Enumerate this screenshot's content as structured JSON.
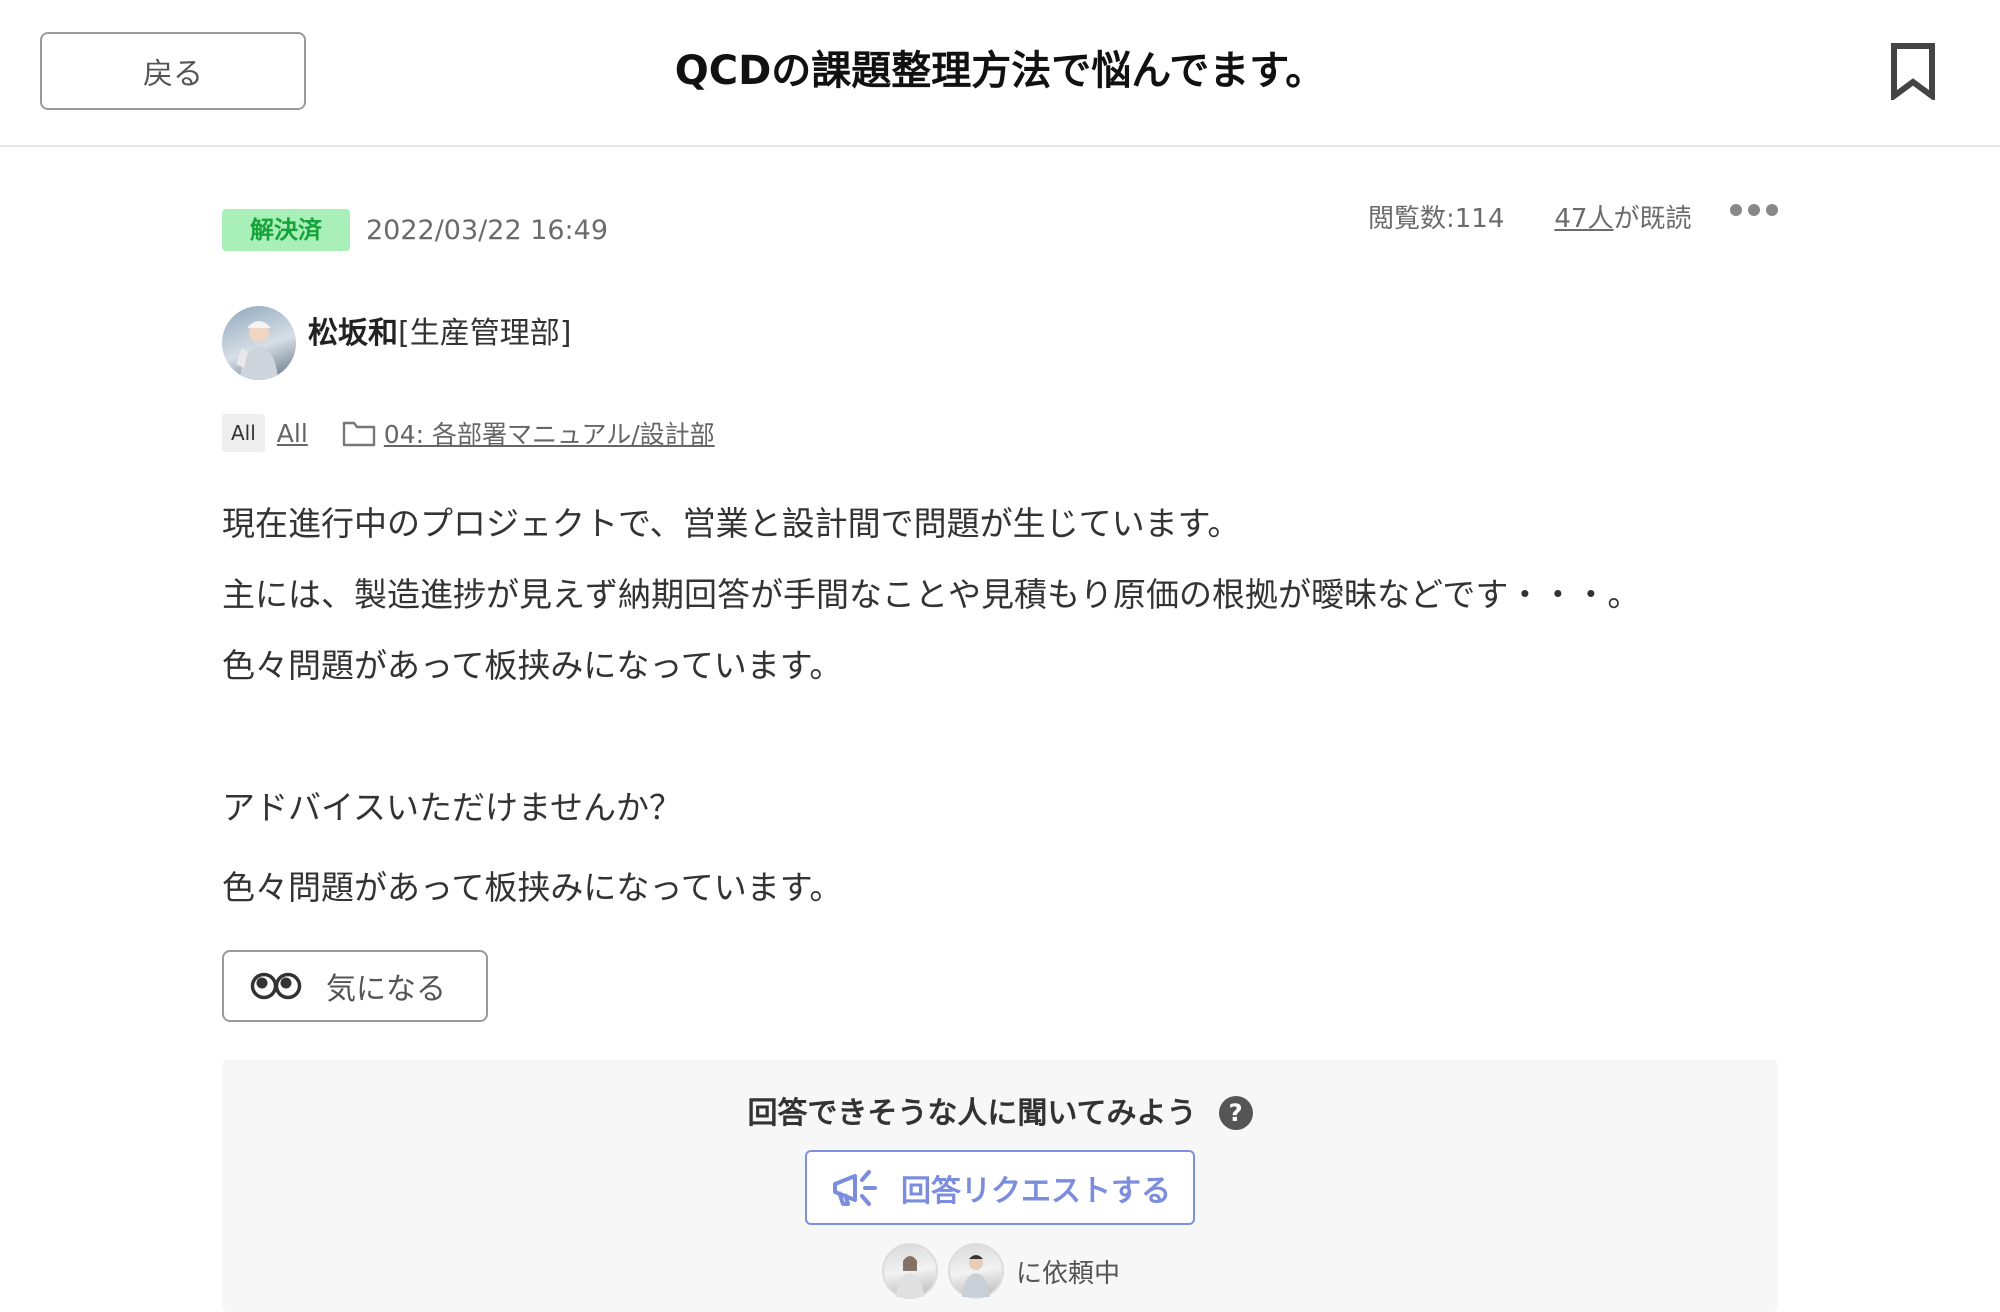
{
  "header": {
    "back_label": "戻る",
    "title": "QCDの課題整理方法で悩んでます。"
  },
  "post": {
    "status": "解決済",
    "date": "2022/03/22 16:49",
    "views": "閲覧数:114",
    "readers_count": "47人",
    "readers_suffix": "が既読",
    "author_name": "松坂和",
    "author_dept": "[生産管理部]",
    "tag_chip": "All",
    "tag_link": "All",
    "folder": "04: 各部署マニュアル/設計部",
    "body": [
      "現在進行中のプロジェクトで、営業と設計間で問題が生じています。",
      "主には、製造進捗が見えず納期回答が手間なことや見積もり原価の根拠が曖昧などです・・・。",
      "色々問題があって板挟みになっています。",
      "",
      "アドバイスいただけませんか？",
      "色々問題があって板挟みになっています。"
    ],
    "concern_label": "気になる"
  },
  "request": {
    "heading": "回答できそうな人に聞いてみよう",
    "button_label": "回答リクエストする",
    "requested_label": "に依頼中"
  },
  "colors": {
    "badge_bg": "#a8f0b8",
    "badge_text": "#15a33a",
    "request_accent": "#7b8ddd"
  }
}
